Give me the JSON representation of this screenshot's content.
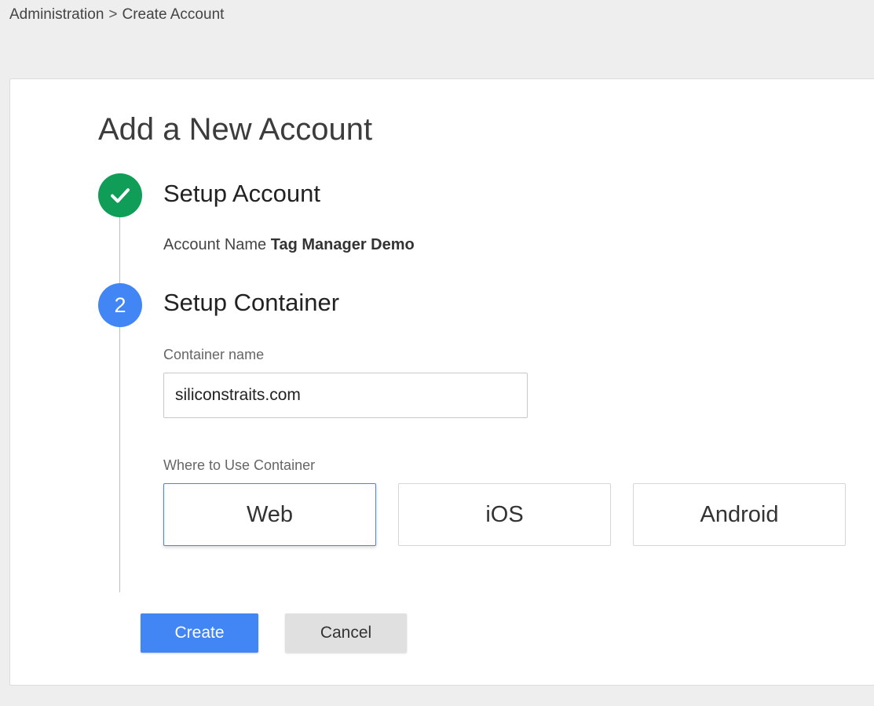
{
  "breadcrumb": {
    "parent": "Administration",
    "separator": ">",
    "current": "Create Account"
  },
  "page": {
    "title": "Add a New Account"
  },
  "step1": {
    "title": "Setup Account",
    "status": "complete",
    "icon": "check-icon",
    "color": "#0f9d58",
    "account_label": "Account Name",
    "account_value": "Tag Manager Demo"
  },
  "step2": {
    "number": "2",
    "title": "Setup Container",
    "color": "#4285f4",
    "container_name_label": "Container name",
    "container_name_value": "siliconstraits.com",
    "where_label": "Where to Use Container",
    "platforms": [
      {
        "label": "Web",
        "selected": true
      },
      {
        "label": "iOS",
        "selected": false
      },
      {
        "label": "Android",
        "selected": false
      }
    ]
  },
  "actions": {
    "create_label": "Create",
    "cancel_label": "Cancel",
    "primary_color": "#4285f4"
  }
}
